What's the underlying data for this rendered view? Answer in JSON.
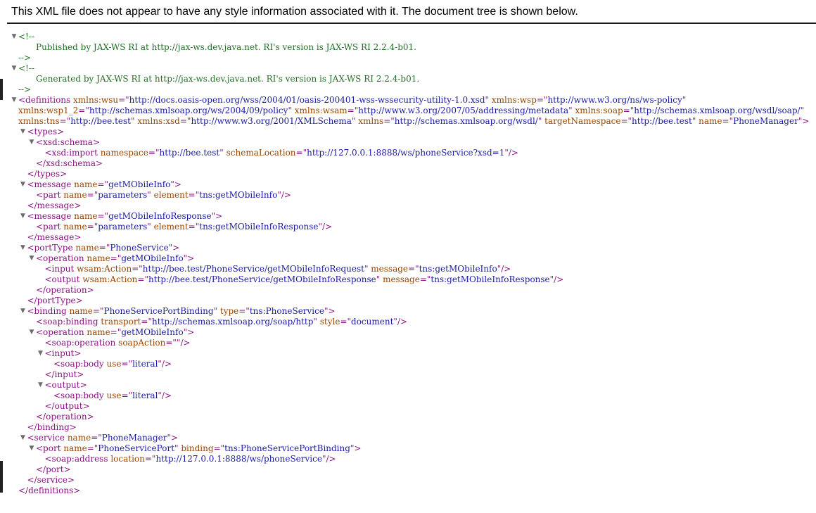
{
  "notice": "This XML file does not appear to have any style information associated with it. The document tree is shown below.",
  "icons": {
    "collapse": "triangle-down-icon"
  },
  "tree": [
    {
      "lvl": 0,
      "tog": true,
      "segs": [
        [
          "c",
          "<!--"
        ]
      ]
    },
    {
      "lvl": 2,
      "segs": [
        [
          "c",
          "Published by JAX-WS RI at http://jax-ws.dev.java.net. RI's version is JAX-WS RI 2.2.4-b01."
        ]
      ]
    },
    {
      "lvl": 0,
      "segs": [
        [
          "c",
          "-->"
        ]
      ]
    },
    {
      "lvl": 0,
      "tog": true,
      "segs": [
        [
          "c",
          "<!--"
        ]
      ]
    },
    {
      "lvl": 2,
      "segs": [
        [
          "c",
          "Generated by JAX-WS RI at http://jax-ws.dev.java.net. RI's version is JAX-WS RI 2.2.4-b01."
        ]
      ]
    },
    {
      "lvl": 0,
      "segs": [
        [
          "c",
          "-->"
        ]
      ]
    },
    {
      "lvl": 0,
      "tog": true,
      "segs": [
        [
          "t",
          "<definitions"
        ],
        [
          "t",
          " "
        ],
        [
          "n",
          "xmlns:wsu"
        ],
        [
          "t",
          "=\""
        ],
        [
          "v",
          "http://docs.oasis-open.org/wss/2004/01/oasis-200401-wss-wssecurity-utility-1.0.xsd"
        ],
        [
          "t",
          "\" "
        ],
        [
          "n",
          "xmlns:wsp"
        ],
        [
          "t",
          "=\""
        ],
        [
          "v",
          "http://www.w3.org/ns/ws-policy"
        ],
        [
          "t",
          "\""
        ]
      ]
    },
    {
      "lvl": 0,
      "segs": [
        [
          "n",
          "xmlns:wsp1_2"
        ],
        [
          "t",
          "=\""
        ],
        [
          "v",
          "http://schemas.xmlsoap.org/ws/2004/09/policy"
        ],
        [
          "t",
          "\" "
        ],
        [
          "n",
          "xmlns:wsam"
        ],
        [
          "t",
          "=\""
        ],
        [
          "v",
          "http://www.w3.org/2007/05/addressing/metadata"
        ],
        [
          "t",
          "\" "
        ],
        [
          "n",
          "xmlns:soap"
        ],
        [
          "t",
          "=\""
        ],
        [
          "v",
          "http://schemas.xmlsoap.org/wsdl/soap/"
        ],
        [
          "t",
          "\""
        ]
      ]
    },
    {
      "lvl": 0,
      "segs": [
        [
          "n",
          "xmlns:tns"
        ],
        [
          "t",
          "=\""
        ],
        [
          "v",
          "http://bee.test"
        ],
        [
          "t",
          "\" "
        ],
        [
          "n",
          "xmlns:xsd"
        ],
        [
          "t",
          "=\""
        ],
        [
          "v",
          "http://www.w3.org/2001/XMLSchema"
        ],
        [
          "t",
          "\" "
        ],
        [
          "n",
          "xmlns"
        ],
        [
          "t",
          "=\""
        ],
        [
          "v",
          "http://schemas.xmlsoap.org/wsdl/"
        ],
        [
          "t",
          "\" "
        ],
        [
          "n",
          "targetNamespace"
        ],
        [
          "t",
          "=\""
        ],
        [
          "v",
          "http://bee.test"
        ],
        [
          "t",
          "\" "
        ],
        [
          "n",
          "name"
        ],
        [
          "t",
          "=\""
        ],
        [
          "v",
          "PhoneManager"
        ],
        [
          "t",
          "\">"
        ]
      ]
    },
    {
      "lvl": 1,
      "tog": true,
      "segs": [
        [
          "t",
          "<types>"
        ]
      ]
    },
    {
      "lvl": 2,
      "tog": true,
      "segs": [
        [
          "t",
          "<xsd:schema>"
        ]
      ]
    },
    {
      "lvl": 3,
      "segs": [
        [
          "t",
          "<xsd:import "
        ],
        [
          "n",
          "namespace"
        ],
        [
          "t",
          "=\""
        ],
        [
          "v",
          "http://bee.test"
        ],
        [
          "t",
          "\" "
        ],
        [
          "n",
          "schemaLocation"
        ],
        [
          "t",
          "=\""
        ],
        [
          "v",
          "http://127.0.0.1:8888/ws/phoneService?xsd=1"
        ],
        [
          "t",
          "\"/>"
        ]
      ]
    },
    {
      "lvl": 2,
      "segs": [
        [
          "t",
          "</xsd:schema>"
        ]
      ]
    },
    {
      "lvl": 1,
      "segs": [
        [
          "t",
          "</types>"
        ]
      ]
    },
    {
      "lvl": 1,
      "tog": true,
      "segs": [
        [
          "t",
          "<message "
        ],
        [
          "n",
          "name"
        ],
        [
          "t",
          "=\""
        ],
        [
          "v",
          "getMObileInfo"
        ],
        [
          "t",
          "\">"
        ]
      ]
    },
    {
      "lvl": 2,
      "segs": [
        [
          "t",
          "<part "
        ],
        [
          "n",
          "name"
        ],
        [
          "t",
          "=\""
        ],
        [
          "v",
          "parameters"
        ],
        [
          "t",
          "\" "
        ],
        [
          "n",
          "element"
        ],
        [
          "t",
          "=\""
        ],
        [
          "v",
          "tns:getMObileInfo"
        ],
        [
          "t",
          "\"/>"
        ]
      ]
    },
    {
      "lvl": 1,
      "segs": [
        [
          "t",
          "</message>"
        ]
      ]
    },
    {
      "lvl": 1,
      "tog": true,
      "segs": [
        [
          "t",
          "<message "
        ],
        [
          "n",
          "name"
        ],
        [
          "t",
          "=\""
        ],
        [
          "v",
          "getMObileInfoResponse"
        ],
        [
          "t",
          "\">"
        ]
      ]
    },
    {
      "lvl": 2,
      "segs": [
        [
          "t",
          "<part "
        ],
        [
          "n",
          "name"
        ],
        [
          "t",
          "=\""
        ],
        [
          "v",
          "parameters"
        ],
        [
          "t",
          "\" "
        ],
        [
          "n",
          "element"
        ],
        [
          "t",
          "=\""
        ],
        [
          "v",
          "tns:getMObileInfoResponse"
        ],
        [
          "t",
          "\"/>"
        ]
      ]
    },
    {
      "lvl": 1,
      "segs": [
        [
          "t",
          "</message>"
        ]
      ]
    },
    {
      "lvl": 1,
      "tog": true,
      "segs": [
        [
          "t",
          "<portType "
        ],
        [
          "n",
          "name"
        ],
        [
          "t",
          "=\""
        ],
        [
          "v",
          "PhoneService"
        ],
        [
          "t",
          "\">"
        ]
      ]
    },
    {
      "lvl": 2,
      "tog": true,
      "segs": [
        [
          "t",
          "<operation "
        ],
        [
          "n",
          "name"
        ],
        [
          "t",
          "=\""
        ],
        [
          "v",
          "getMObileInfo"
        ],
        [
          "t",
          "\">"
        ]
      ]
    },
    {
      "lvl": 3,
      "segs": [
        [
          "t",
          "<input "
        ],
        [
          "n",
          "wsam:Action"
        ],
        [
          "t",
          "=\""
        ],
        [
          "v",
          "http://bee.test/PhoneService/getMObileInfoRequest"
        ],
        [
          "t",
          "\" "
        ],
        [
          "n",
          "message"
        ],
        [
          "t",
          "=\""
        ],
        [
          "v",
          "tns:getMObileInfo"
        ],
        [
          "t",
          "\"/>"
        ]
      ]
    },
    {
      "lvl": 3,
      "segs": [
        [
          "t",
          "<output "
        ],
        [
          "n",
          "wsam:Action"
        ],
        [
          "t",
          "=\""
        ],
        [
          "v",
          "http://bee.test/PhoneService/getMObileInfoResponse"
        ],
        [
          "t",
          "\" "
        ],
        [
          "n",
          "message"
        ],
        [
          "t",
          "=\""
        ],
        [
          "v",
          "tns:getMObileInfoResponse"
        ],
        [
          "t",
          "\"/>"
        ]
      ]
    },
    {
      "lvl": 2,
      "segs": [
        [
          "t",
          "</operation>"
        ]
      ]
    },
    {
      "lvl": 1,
      "segs": [
        [
          "t",
          "</portType>"
        ]
      ]
    },
    {
      "lvl": 1,
      "tog": true,
      "segs": [
        [
          "t",
          "<binding "
        ],
        [
          "n",
          "name"
        ],
        [
          "t",
          "=\""
        ],
        [
          "v",
          "PhoneServicePortBinding"
        ],
        [
          "t",
          "\" "
        ],
        [
          "n",
          "type"
        ],
        [
          "t",
          "=\""
        ],
        [
          "v",
          "tns:PhoneService"
        ],
        [
          "t",
          "\">"
        ]
      ]
    },
    {
      "lvl": 2,
      "segs": [
        [
          "t",
          "<soap:binding "
        ],
        [
          "n",
          "transport"
        ],
        [
          "t",
          "=\""
        ],
        [
          "v",
          "http://schemas.xmlsoap.org/soap/http"
        ],
        [
          "t",
          "\" "
        ],
        [
          "n",
          "style"
        ],
        [
          "t",
          "=\""
        ],
        [
          "v",
          "document"
        ],
        [
          "t",
          "\"/>"
        ]
      ]
    },
    {
      "lvl": 2,
      "tog": true,
      "segs": [
        [
          "t",
          "<operation "
        ],
        [
          "n",
          "name"
        ],
        [
          "t",
          "=\""
        ],
        [
          "v",
          "getMObileInfo"
        ],
        [
          "t",
          "\">"
        ]
      ]
    },
    {
      "lvl": 3,
      "segs": [
        [
          "t",
          "<soap:operation "
        ],
        [
          "n",
          "soapAction"
        ],
        [
          "t",
          "=\"\"/>"
        ]
      ]
    },
    {
      "lvl": 3,
      "tog": true,
      "segs": [
        [
          "t",
          "<input>"
        ]
      ]
    },
    {
      "lvl": 4,
      "segs": [
        [
          "t",
          "<soap:body "
        ],
        [
          "n",
          "use"
        ],
        [
          "t",
          "=\""
        ],
        [
          "v",
          "literal"
        ],
        [
          "t",
          "\"/>"
        ]
      ]
    },
    {
      "lvl": 3,
      "segs": [
        [
          "t",
          "</input>"
        ]
      ]
    },
    {
      "lvl": 3,
      "tog": true,
      "segs": [
        [
          "t",
          "<output>"
        ]
      ]
    },
    {
      "lvl": 4,
      "segs": [
        [
          "t",
          "<soap:body "
        ],
        [
          "n",
          "use"
        ],
        [
          "t",
          "=\""
        ],
        [
          "v",
          "literal"
        ],
        [
          "t",
          "\"/>"
        ]
      ]
    },
    {
      "lvl": 3,
      "segs": [
        [
          "t",
          "</output>"
        ]
      ]
    },
    {
      "lvl": 2,
      "segs": [
        [
          "t",
          "</operation>"
        ]
      ]
    },
    {
      "lvl": 1,
      "segs": [
        [
          "t",
          "</binding>"
        ]
      ]
    },
    {
      "lvl": 1,
      "tog": true,
      "segs": [
        [
          "t",
          "<service "
        ],
        [
          "n",
          "name"
        ],
        [
          "t",
          "=\""
        ],
        [
          "v",
          "PhoneManager"
        ],
        [
          "t",
          "\">"
        ]
      ]
    },
    {
      "lvl": 2,
      "tog": true,
      "segs": [
        [
          "t",
          "<port "
        ],
        [
          "n",
          "name"
        ],
        [
          "t",
          "=\""
        ],
        [
          "v",
          "PhoneServicePort"
        ],
        [
          "t",
          "\" "
        ],
        [
          "n",
          "binding"
        ],
        [
          "t",
          "=\""
        ],
        [
          "v",
          "tns:PhoneServicePortBinding"
        ],
        [
          "t",
          "\">"
        ]
      ]
    },
    {
      "lvl": 3,
      "segs": [
        [
          "t",
          "<soap:address "
        ],
        [
          "n",
          "location"
        ],
        [
          "t",
          "=\""
        ],
        [
          "v",
          "http://127.0.0.1:8888/ws/phoneService"
        ],
        [
          "t",
          "\"/>"
        ]
      ]
    },
    {
      "lvl": 2,
      "segs": [
        [
          "t",
          "</port>"
        ]
      ]
    },
    {
      "lvl": 1,
      "segs": [
        [
          "t",
          "</service>"
        ]
      ]
    },
    {
      "lvl": 0,
      "segs": [
        [
          "t",
          "</definitions>"
        ]
      ]
    }
  ]
}
